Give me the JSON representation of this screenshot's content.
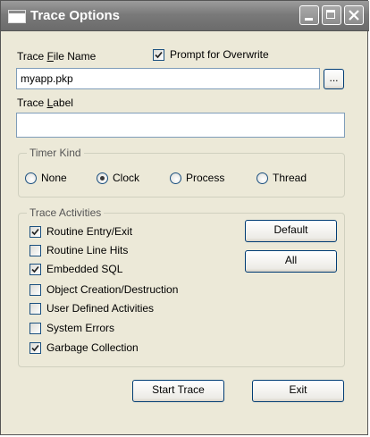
{
  "window": {
    "title": "Trace Options"
  },
  "trace_file": {
    "label_pre": "Trace ",
    "label_accel": "F",
    "label_post": "ile Name",
    "value": "myapp.pkp",
    "browse_label": "...",
    "prompt_overwrite_label": "Prompt for Overwrite",
    "prompt_overwrite_checked": true
  },
  "trace_label": {
    "label_pre": "Trace ",
    "label_accel": "L",
    "label_post": "abel",
    "value": ""
  },
  "timer_kind": {
    "legend": "Timer Kind",
    "options": [
      {
        "label": "None",
        "selected": false
      },
      {
        "label": "Clock",
        "selected": true
      },
      {
        "label": "Process",
        "selected": false
      },
      {
        "label": "Thread",
        "selected": false
      }
    ]
  },
  "trace_activities": {
    "legend": "Trace Activities",
    "items": [
      {
        "label": "Routine Entry/Exit",
        "checked": true
      },
      {
        "label": "Routine Line Hits",
        "checked": false
      },
      {
        "label": "Embedded SQL",
        "checked": true
      },
      {
        "label": "Object Creation/Destruction",
        "checked": false
      },
      {
        "label": "User Defined Activities",
        "checked": false
      },
      {
        "label": "System Errors",
        "checked": false
      },
      {
        "label": "Garbage Collection",
        "checked": true
      }
    ],
    "default_button": "Default",
    "all_button": "All"
  },
  "footer": {
    "start_button": "Start Trace",
    "exit_button": "Exit"
  }
}
